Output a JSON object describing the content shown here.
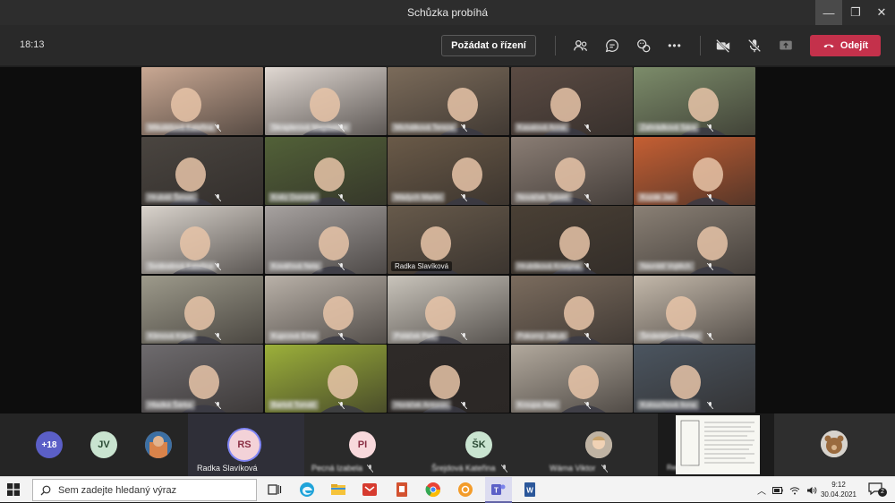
{
  "window": {
    "title": "Schůzka probíhá",
    "controls": {
      "minimize": "—",
      "maximize": "❐",
      "close": "✕"
    }
  },
  "toolbar": {
    "clock": "18:13",
    "request_control_label": "Požádat o řízení",
    "more_label": "•••",
    "leave_label": "Odejít",
    "icons": [
      "participants-icon",
      "chat-icon",
      "reactions-icon",
      "more-icon",
      "camera-off-icon",
      "mic-off-icon",
      "share-icon",
      "phone-hangup-icon"
    ]
  },
  "colors": {
    "leave_button": "#c4314b",
    "accent": "#6264a7",
    "stage_bg": "#0d0d0d",
    "toolbar_bg": "#292929"
  },
  "grid": {
    "tiles": [
      {
        "name": "Mikulášová Kateřina",
        "muted": true,
        "bg": "#c9a893",
        "blurred": true
      },
      {
        "name": "Skraplerová Magdaléna",
        "muted": true,
        "bg": "#e0d8d2",
        "blurred": true
      },
      {
        "name": "Michálková Tereza",
        "muted": true,
        "bg": "#7b6b5a",
        "blurred": true
      },
      {
        "name": "Kasalová Anna",
        "muted": true,
        "bg": "#5b4b43",
        "blurred": true
      },
      {
        "name": "Zahrádková Sára",
        "muted": true,
        "bg": "#7c8c6a",
        "blurred": true
      },
      {
        "name": "Hrubáš Šimon",
        "muted": true,
        "bg": "#4a4540",
        "blurred": true
      },
      {
        "name": "Kněz Dominik",
        "muted": true,
        "bg": "#526138",
        "blurred": true
      },
      {
        "name": "Mádych Martin",
        "muted": true,
        "bg": "#6a5a48",
        "blurred": true
      },
      {
        "name": "Nováček Tobiáš",
        "muted": true,
        "bg": "#8a7d74",
        "blurred": true
      },
      {
        "name": "Kozák Jan",
        "muted": true,
        "bg": "#c55f33",
        "blurred": true
      },
      {
        "name": "Svobodová Kateřina",
        "muted": true,
        "bg": "#d9d3cc",
        "blurred": true
      },
      {
        "name": "Kovářová Nela",
        "muted": true,
        "bg": "#a7a2a0",
        "blurred": true
      },
      {
        "name": "Radka Slavíková",
        "muted": false,
        "bg": "#675a4b",
        "blurred": false
      },
      {
        "name": "Hrubšková Kristýna",
        "muted": true,
        "bg": "#4a4035",
        "blurred": true
      },
      {
        "name": "Navrátil Vojtěch",
        "muted": true,
        "bg": "#8a8075",
        "blurred": true
      },
      {
        "name": "Klimová Klára",
        "muted": true,
        "bg": "#9d9a8b",
        "blurred": true
      },
      {
        "name": "Kupcová Ema",
        "muted": true,
        "bg": "#b9b1a8",
        "blurred": true
      },
      {
        "name": "Poláček Petr",
        "muted": true,
        "bg": "#c9c4bb",
        "blurred": true
      },
      {
        "name": "Pokorný Jakub",
        "muted": true,
        "bg": "#7b6c5e",
        "blurred": true
      },
      {
        "name": "Šindelářová Aneta",
        "muted": true,
        "bg": "#c3b8aa",
        "blurred": true
      },
      {
        "name": "Hladká Šárka",
        "muted": true,
        "bg": "#6e6b6e",
        "blurred": true
      },
      {
        "name": "Bartoš Tomáš",
        "muted": true,
        "bg": "#9cb03a",
        "blurred": true
      },
      {
        "name": "Horáček Antonín",
        "muted": true,
        "bg": "#2e2a28",
        "blurred": true
      },
      {
        "name": "Kroupa Alex",
        "muted": true,
        "bg": "#b2a99d",
        "blurred": true
      },
      {
        "name": "Kolouchová Ilona",
        "muted": true,
        "bg": "#4b5560",
        "blurred": true
      }
    ]
  },
  "strip": {
    "overflow_count": "+18",
    "jv_initials": "JV",
    "rs_initials": "RS",
    "rs_name": "Radka Slavíková",
    "pi_initials": "PI",
    "pi_name": "Pecná Izabela",
    "sk_initials": "ŠK",
    "sk_name": "Šrejdová Kateřina",
    "wagner_name": "Wáma Viktor",
    "doc_name": "Remes..."
  },
  "taskbar": {
    "search_placeholder": "Sem zadejte hledaný výraz",
    "time": "9:12",
    "date": "30.04.2021",
    "notifications": "2",
    "apps": [
      "task-view-icon",
      "edge-icon",
      "file-explorer-icon",
      "mail-icon",
      "powerpoint-icon",
      "chrome-icon",
      "settings-icon",
      "teams-icon",
      "word-icon"
    ]
  }
}
